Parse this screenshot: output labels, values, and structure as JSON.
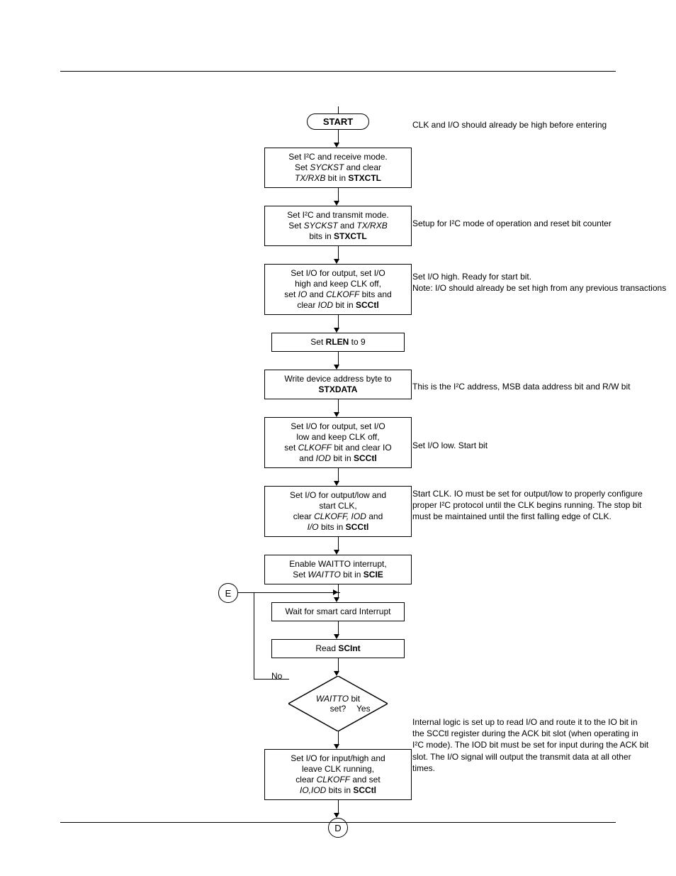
{
  "start": "START",
  "steps": {
    "s1": {
      "line1": "Set I²C and receive mode.",
      "line2": "Set ",
      "s2a": "SYCKST",
      "line3": " and clear",
      "line4": "TX/RXB",
      "line5": " bit in ",
      "s2b": "STXCTL"
    },
    "s2": {
      "line1": "Set I²C and transmit mode.",
      "line2": "Set ",
      "a": "SYCKST",
      "line3": " and ",
      "b": "TX/RXB",
      "line4": "bits in ",
      "c": "STXCTL"
    },
    "s3": {
      "l1": "Set I/O for output, set I/O",
      "l2": "high and keep CLK off,",
      "l3": "set ",
      "a": "IO",
      "l4": " and ",
      "b": "CLKOFF",
      "l5": " bits and",
      "l6": "clear ",
      "c": "IOD",
      "l7": " bit in ",
      "d": "SCCtl"
    },
    "s4": {
      "l1": "Set ",
      "a": "RLEN",
      "l2": " to 9"
    },
    "s5": {
      "l1": "Write device address byte to",
      "a": "STXDATA"
    },
    "s6": {
      "l1": "Set I/O for output, set I/O",
      "l2": "low and keep CLK off,",
      "l3": "set ",
      "a": "CLKOFF",
      "l4": " bit and clear IO",
      "l5": "and ",
      "b": "IOD",
      "l6": " bit in ",
      "c": "SCCtl"
    },
    "s7": {
      "l1": "Set I/O for output/low and",
      "l2": "start CLK,",
      "l3": "clear ",
      "a": "CLKOFF, IOD",
      "l4": " and",
      "l5": "I/O",
      "l6": " bits in ",
      "b": "SCCtl"
    },
    "s8": {
      "l1": "Enable WAITTO interrupt,",
      "l2": "Set ",
      "a": "WAITTO",
      "l3": " bit in ",
      "b": "SCIE"
    },
    "s9": {
      "l1": "Wait for smart card Interrupt"
    },
    "s10": {
      "l1": "Read ",
      "a": "SCInt"
    },
    "dec": {
      "l1": "WAITTO",
      "l2": " bit",
      "l3": "set?"
    },
    "s11": {
      "l1": "Set I/O for input/high and",
      "l2": "leave CLK running,",
      "l3": "clear ",
      "a": "CLKOFF",
      "l4": " and set",
      "l5": "IO,IOD",
      "l6": " bits in ",
      "b": "SCCtl"
    }
  },
  "connectors": {
    "E": "E",
    "D": "D"
  },
  "labels": {
    "no": "No",
    "yes": "Yes"
  },
  "annot": {
    "a0": "CLK and I/O should already be high before entering",
    "a2": "Setup for I²C mode of operation and reset bit counter",
    "a3a": "Set I/O high.  Ready for start bit.",
    "a3b": "Note: I/O should already be set high from any previous transactions",
    "a5": "This is the I²C address, MSB data address bit and R/W bit",
    "a6": "Set I/O low.  Start bit",
    "a7": "Start CLK.  IO must be set for output/low to properly configure proper I²C protocol until the CLK begins running. The stop bit must be maintained until the first falling edge of CLK.",
    "a11": "Internal logic is set up to read I/O and route it to the IO bit in the SCCtl register during the ACK bit slot (when operating in I²C mode).  The IOD bit must be set for input during the ACK bit slot. The I/O signal will output the transmit data at all other times."
  }
}
